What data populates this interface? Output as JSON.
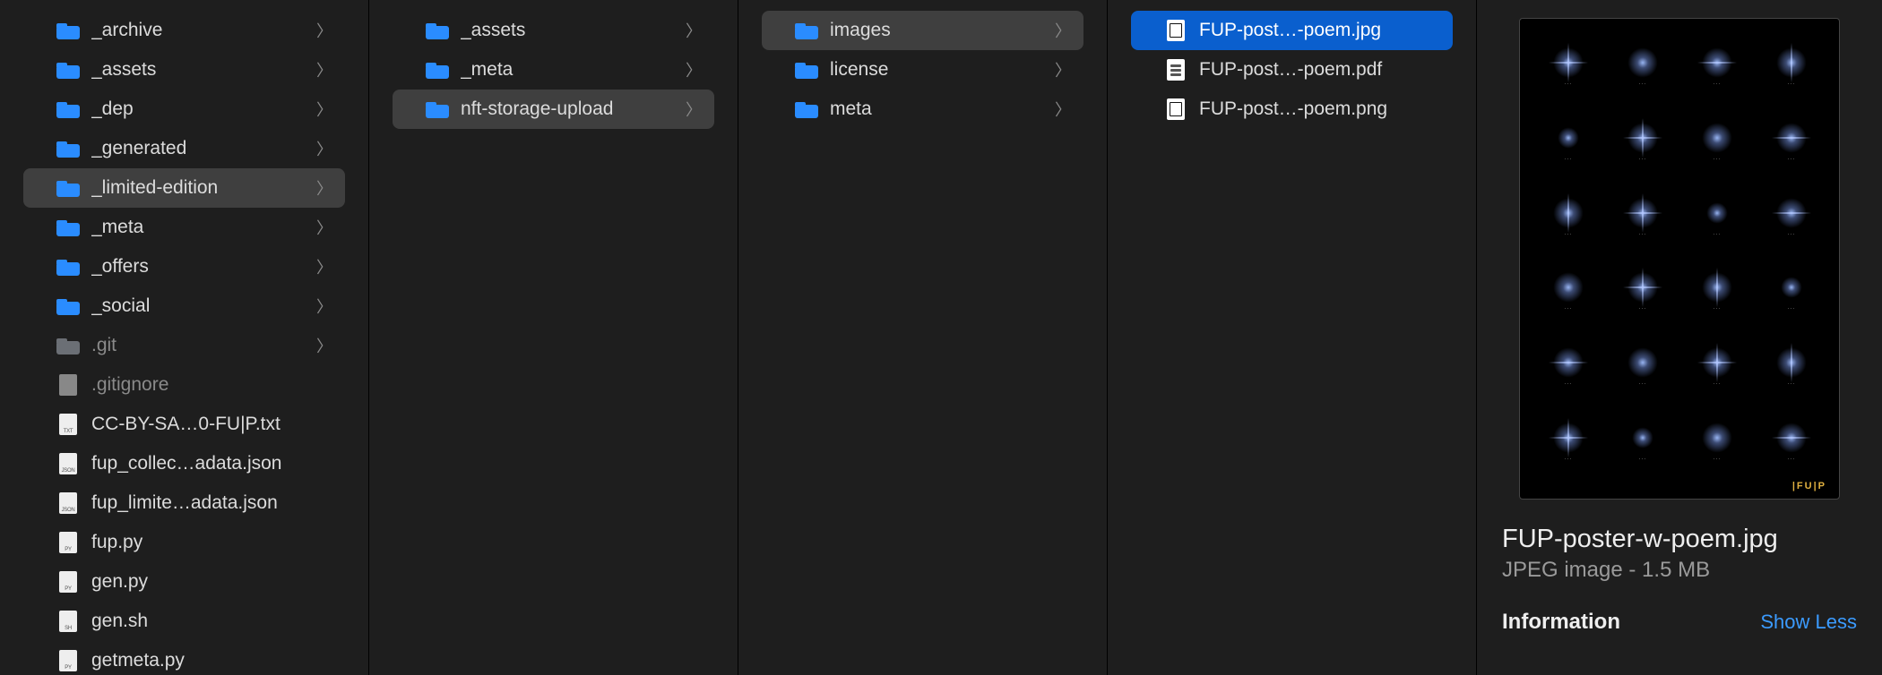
{
  "col1": {
    "items": [
      {
        "label": "_archive",
        "type": "folder",
        "hasChildren": true
      },
      {
        "label": "_assets",
        "type": "folder",
        "hasChildren": true
      },
      {
        "label": "_dep",
        "type": "folder",
        "hasChildren": true
      },
      {
        "label": "_generated",
        "type": "folder",
        "hasChildren": true
      },
      {
        "label": "_limited-edition",
        "type": "folder",
        "hasChildren": true,
        "pathSelected": true
      },
      {
        "label": "_meta",
        "type": "folder",
        "hasChildren": true
      },
      {
        "label": "_offers",
        "type": "folder",
        "hasChildren": true
      },
      {
        "label": "_social",
        "type": "folder",
        "hasChildren": true
      },
      {
        "label": ".git",
        "type": "folder",
        "hasChildren": true,
        "dim": true
      },
      {
        "label": ".gitignore",
        "type": "file",
        "ext": "",
        "dim": true
      },
      {
        "label": "CC-BY-SA…0-FU|P.txt",
        "type": "file",
        "ext": "TXT"
      },
      {
        "label": "fup_collec…adata.json",
        "type": "file",
        "ext": "JSON"
      },
      {
        "label": "fup_limite…adata.json",
        "type": "file",
        "ext": "JSON"
      },
      {
        "label": "fup.py",
        "type": "file",
        "ext": "PY"
      },
      {
        "label": "gen.py",
        "type": "file",
        "ext": "PY"
      },
      {
        "label": "gen.sh",
        "type": "file",
        "ext": "SH"
      },
      {
        "label": "getmeta.py",
        "type": "file",
        "ext": "PY"
      }
    ]
  },
  "col2": {
    "items": [
      {
        "label": "_assets",
        "type": "folder",
        "hasChildren": true
      },
      {
        "label": "_meta",
        "type": "folder",
        "hasChildren": true
      },
      {
        "label": "nft-storage-upload",
        "type": "folder",
        "hasChildren": true,
        "pathSelected": true
      }
    ]
  },
  "col3": {
    "items": [
      {
        "label": "images",
        "type": "folder",
        "hasChildren": true,
        "pathSelected": true
      },
      {
        "label": "license",
        "type": "folder",
        "hasChildren": true
      },
      {
        "label": "meta",
        "type": "folder",
        "hasChildren": true
      }
    ]
  },
  "col4": {
    "items": [
      {
        "label": "FUP-post…-poem.jpg",
        "type": "imgfile",
        "fileSelected": true
      },
      {
        "label": "FUP-post…-poem.pdf",
        "type": "pdffile"
      },
      {
        "label": "FUP-post…-poem.png",
        "type": "imgfile"
      }
    ]
  },
  "preview": {
    "filename": "FUP-poster-w-poem.jpg",
    "subtitle": "JPEG image - 1.5 MB",
    "info_label": "Information",
    "show_less": "Show Less",
    "signature": "|FU|P"
  }
}
